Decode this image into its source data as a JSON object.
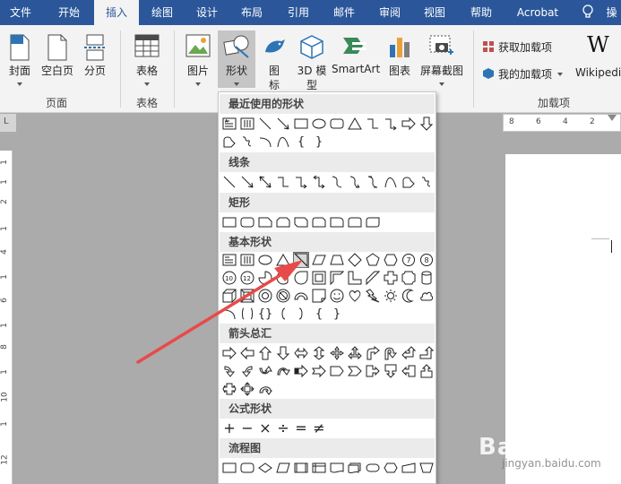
{
  "menu": {
    "tabs": [
      "文件",
      "开始",
      "插入",
      "绘图",
      "设计",
      "布局",
      "引用",
      "邮件",
      "审阅",
      "视图",
      "帮助",
      "Acrobat",
      "操"
    ],
    "active_tab": "插入"
  },
  "ribbon": {
    "pages": {
      "cover": "封面",
      "blank": "空白页",
      "break": "分页",
      "group": "页面"
    },
    "tables": {
      "table": "表格",
      "group": "表格"
    },
    "illustrations": {
      "pictures": "图片",
      "shapes": "形状",
      "icons_line1": "图",
      "icons_line2": "标",
      "model3d_line1": "3D 模",
      "model3d_line2": "型",
      "smartart": "SmartArt",
      "chart": "图表",
      "screenshot": "屏幕截图"
    },
    "addins": {
      "get": "获取加载项",
      "my": "我的加载项",
      "wiki": "Wikipedi",
      "group": "加载项"
    }
  },
  "rulers": {
    "corner": "L",
    "h_ticks": [
      "8",
      "6",
      "4",
      "2"
    ],
    "v_ticks": [
      "1",
      "1",
      "2",
      "1",
      "4",
      "1",
      "6",
      "1",
      "8",
      "1",
      "10",
      "1",
      "12"
    ]
  },
  "gallery": {
    "categories": [
      "最近使用的形状",
      "线条",
      "矩形",
      "基本形状",
      "箭头总汇",
      "公式形状",
      "流程图"
    ],
    "recent_shape_texts": [
      "{",
      "}"
    ],
    "basic_shape_texts": [
      "7",
      "8",
      "10",
      "12",
      "{",
      "}",
      "{}",
      "{",
      "}",
      "{",
      "}"
    ],
    "equation_shapes": [
      "+",
      "−",
      "×",
      "÷",
      "=",
      "≠"
    ],
    "selected_shape": "diagonal-stripe-shape"
  },
  "watermark": {
    "brand": "Bai经验",
    "url": "jingyan.baidu.com"
  },
  "colors": {
    "accent": "#2b579a",
    "arrow": "#e84a4a"
  }
}
